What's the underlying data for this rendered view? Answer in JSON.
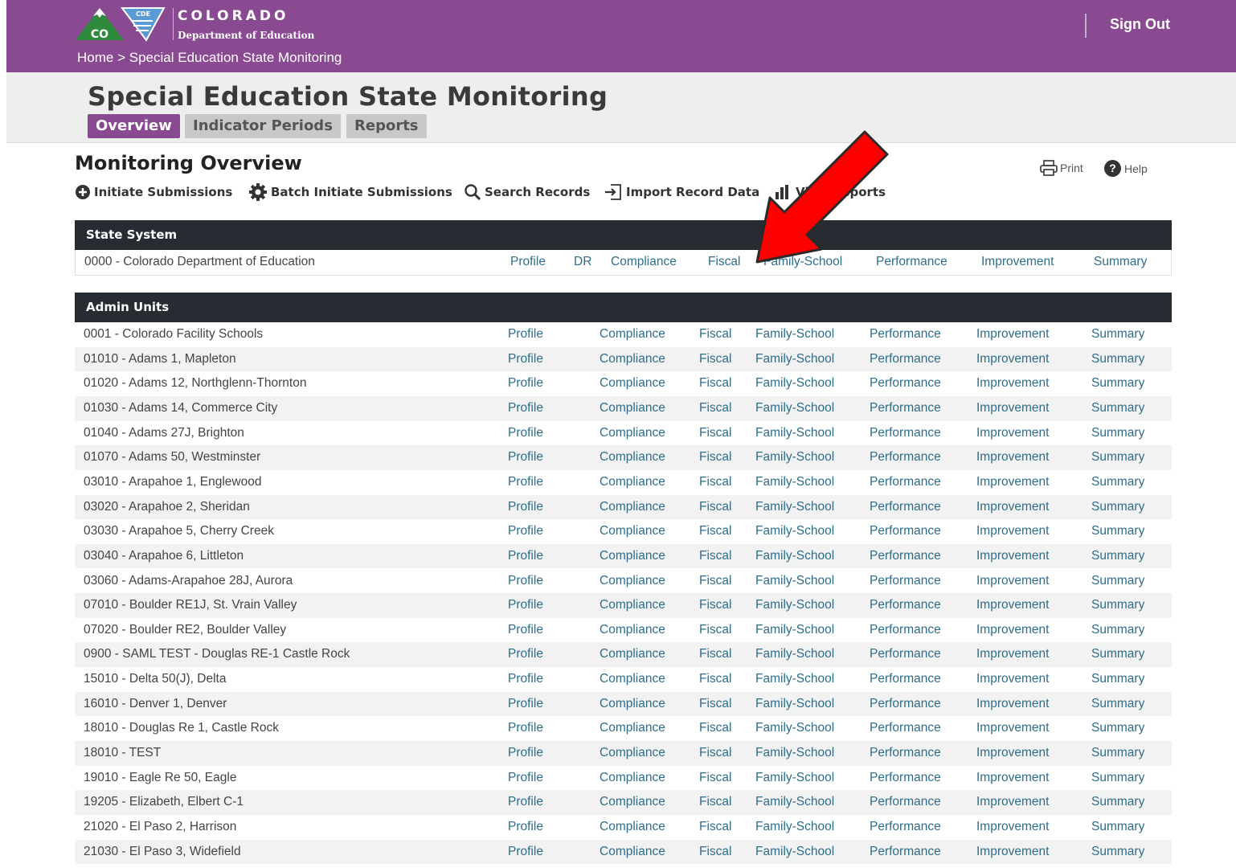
{
  "header": {
    "logo_word": "COLORADO",
    "logo_sub": "Department of Education",
    "logo_badge_co": "CO",
    "logo_badge_cde": "CDE",
    "breadcrumb": [
      "Home",
      ">",
      "Special Education State Monitoring"
    ],
    "sign_out": "Sign Out"
  },
  "colors": {
    "brand": "#8a4a92",
    "link": "#2e6d8a",
    "table_header": "#262c31",
    "arrow": "#ff0000"
  },
  "page": {
    "title": "Special Education State Monitoring",
    "tabs": [
      "Overview",
      "Indicator Periods",
      "Reports"
    ],
    "active_tab": "Overview"
  },
  "section": {
    "title": "Monitoring Overview",
    "print": "Print",
    "help": "Help",
    "actions": [
      {
        "label": "Initiate Submissions",
        "icon": "plus-circle-icon"
      },
      {
        "label": "Batch Initiate Submissions",
        "icon": "gear-icon"
      },
      {
        "label": "Search Records",
        "icon": "search-icon"
      },
      {
        "label": "Import Record Data",
        "icon": "import-icon"
      },
      {
        "label": "View Reports",
        "icon": "bar-chart-icon"
      }
    ]
  },
  "state_system": {
    "header": "State System",
    "row": {
      "name": "0000 - Colorado Department of Education",
      "links": [
        "Profile",
        "DR",
        "Compliance",
        "Fiscal",
        "Family-School",
        "Performance",
        "Improvement",
        "Summary"
      ]
    }
  },
  "admin_units": {
    "header": "Admin Units",
    "links": [
      "Profile",
      "Compliance",
      "Fiscal",
      "Family-School",
      "Performance",
      "Improvement",
      "Summary"
    ],
    "rows": [
      "0001 - Colorado Facility Schools",
      "01010 - Adams 1, Mapleton",
      "01020 - Adams 12, Northglenn-Thornton",
      "01030 - Adams 14, Commerce City",
      "01040 - Adams 27J, Brighton",
      "01070 - Adams 50, Westminster",
      "03010 - Arapahoe 1, Englewood",
      "03020 - Arapahoe 2, Sheridan",
      "03030 - Arapahoe 5, Cherry Creek",
      "03040 - Arapahoe 6, Littleton",
      "03060 - Adams-Arapahoe 28J, Aurora",
      "07010 - Boulder RE1J, St. Vrain Valley",
      "07020 - Boulder RE2, Boulder Valley",
      "0900 - SAML TEST - Douglas RE-1 Castle Rock",
      "15010 - Delta 50(J), Delta",
      "16010 - Denver 1, Denver",
      "18010 - Douglas Re 1, Castle Rock",
      "18010 - TEST",
      "19010 - Eagle Re 50, Eagle",
      "19205 - Elizabeth, Elbert C-1",
      "21020 - El Paso 2, Harrison",
      "21030 - El Paso 3, Widefield"
    ]
  }
}
